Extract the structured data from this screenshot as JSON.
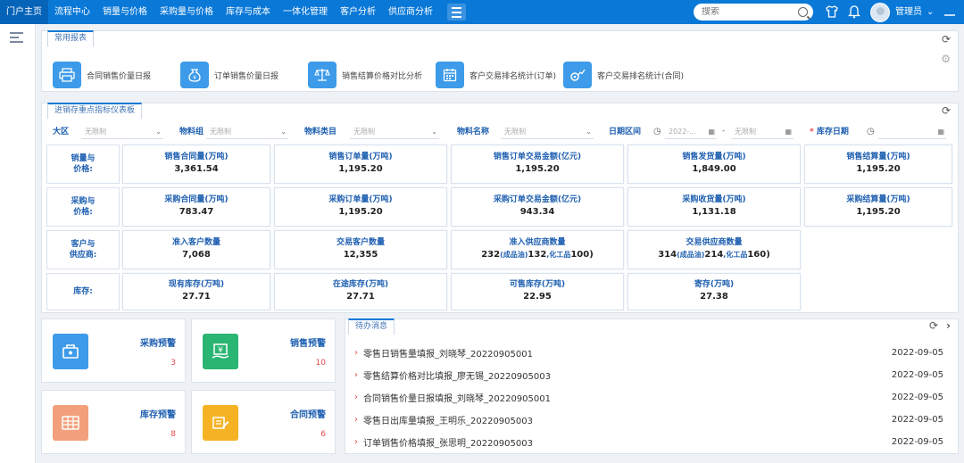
{
  "nav": {
    "items": [
      "门户主页",
      "流程中心",
      "销量与价格",
      "采购量与价格",
      "库存与成本",
      "一体化管理",
      "客户分析",
      "供应商分析"
    ]
  },
  "search": {
    "placeholder": "搜索"
  },
  "user": {
    "name": "管理员"
  },
  "common_reports": {
    "tab": "常用报表",
    "items": [
      {
        "label": "合同销售价量日报",
        "icon": "printer-icon"
      },
      {
        "label": "订单销售价量日报",
        "icon": "money-bag-icon"
      },
      {
        "label": "销售结算价格对比分析",
        "icon": "scale-icon"
      },
      {
        "label": "客户交易排名统计(订单)",
        "icon": "calendar-icon"
      },
      {
        "label": "客户交易排名统计(合同)",
        "icon": "gear-chart-icon"
      }
    ]
  },
  "dashboard": {
    "tab": "进销存重点指标仪表板",
    "filters": {
      "region": {
        "label": "大区",
        "value": "无限制"
      },
      "material_group": {
        "label": "物料组",
        "value": "无限制"
      },
      "material_category": {
        "label": "物料类目",
        "value": "无限制"
      },
      "material_name": {
        "label": "物料名称",
        "value": "无限制"
      },
      "date_range": {
        "label": "日期区间",
        "start": "2022-...",
        "sep": "-",
        "end": "无限制"
      },
      "stock_date": {
        "label": "库存日期",
        "star": "*"
      }
    },
    "rows": [
      {
        "label_line1": "销量与",
        "label_line2": "价格:",
        "cells": [
          {
            "title": "销售合同量(万吨)",
            "value": "3,361.54"
          },
          {
            "title": "销售订单量(万吨)",
            "value": "1,195.20"
          },
          {
            "title": "销售订单交易金额(亿元)",
            "value": "1,195.20"
          },
          {
            "title": "销售发货量(万吨)",
            "value": "1,849.00"
          },
          {
            "title": "销售结算量(万吨)",
            "value": "1,195.20"
          }
        ]
      },
      {
        "label_line1": "采购与",
        "label_line2": "价格:",
        "cells": [
          {
            "title": "采购合同量(万吨)",
            "value": "783.47"
          },
          {
            "title": "采购订单量(万吨)",
            "value": "1,195.20"
          },
          {
            "title": "采购订单交易金额(亿元)",
            "value": "943.34"
          },
          {
            "title": "采购收货量(万吨)",
            "value": "1,131.18"
          },
          {
            "title": "采购结算量(万吨)",
            "value": "1,195.20"
          }
        ]
      },
      {
        "label_line1": "客户与",
        "label_line2": "供应商:",
        "cells": [
          {
            "title": "准入客户数量",
            "value": "7,068"
          },
          {
            "title": "交易客户数量",
            "value": "12,355"
          },
          {
            "title": "准入供应商数量",
            "value": "232",
            "s1": "(成品油)",
            "v2": "132",
            "s2": ",化工品",
            "v3": "100)"
          },
          {
            "title": "交易供应商数量",
            "value": "314",
            "s1": "(成品油)",
            "v2": "214",
            "s2": ",化工品",
            "v3": "160)"
          }
        ]
      },
      {
        "label_line1": "库存:",
        "label_line2": "",
        "cells": [
          {
            "title": "现有库存(万吨)",
            "value": "27.71"
          },
          {
            "title": "在途库存(万吨)",
            "value": "27.71"
          },
          {
            "title": "可售库存(万吨)",
            "value": "22.95"
          },
          {
            "title": "寄存(万吨)",
            "value": "27.38"
          }
        ]
      }
    ]
  },
  "warnings": [
    {
      "title": "采购预警",
      "count": "3",
      "color": "#3d9be9",
      "icon": "cart-icon"
    },
    {
      "title": "销售预警",
      "count": "10",
      "color": "#2bb573",
      "icon": "yen-icon"
    },
    {
      "title": "库存预警",
      "count": "8",
      "color": "#f2a07b",
      "icon": "inventory-icon"
    },
    {
      "title": "合同预警",
      "count": "6",
      "color": "#f5b324",
      "icon": "contract-icon"
    }
  ],
  "todo": {
    "tab": "待办消息",
    "items": [
      {
        "text": "零售日销售量填报_刘晓琴_20220905001",
        "date": "2022-09-05"
      },
      {
        "text": "零售结算价格对比填报_廖无锡_20220905003",
        "date": "2022-09-05"
      },
      {
        "text": "合同销售价量日报填报_刘晓琴_20220905001",
        "date": "2022-09-05"
      },
      {
        "text": "零售日出库量填报_王明乐_20220905003",
        "date": "2022-09-05"
      },
      {
        "text": "订单销售价格填报_张思明_20220905003",
        "date": "2022-09-05"
      }
    ]
  }
}
